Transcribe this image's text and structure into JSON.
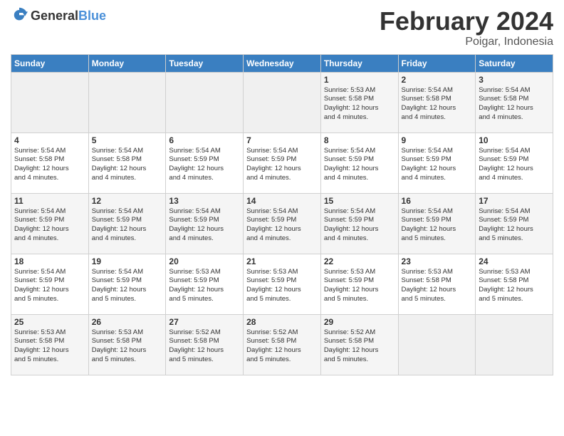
{
  "header": {
    "logo_general": "General",
    "logo_blue": "Blue",
    "month_year": "February 2024",
    "location": "Poigar, Indonesia"
  },
  "weekdays": [
    "Sunday",
    "Monday",
    "Tuesday",
    "Wednesday",
    "Thursday",
    "Friday",
    "Saturday"
  ],
  "weeks": [
    [
      {
        "day": "",
        "info": ""
      },
      {
        "day": "",
        "info": ""
      },
      {
        "day": "",
        "info": ""
      },
      {
        "day": "",
        "info": ""
      },
      {
        "day": "1",
        "info": "Sunrise: 5:53 AM\nSunset: 5:58 PM\nDaylight: 12 hours\nand 4 minutes."
      },
      {
        "day": "2",
        "info": "Sunrise: 5:54 AM\nSunset: 5:58 PM\nDaylight: 12 hours\nand 4 minutes."
      },
      {
        "day": "3",
        "info": "Sunrise: 5:54 AM\nSunset: 5:58 PM\nDaylight: 12 hours\nand 4 minutes."
      }
    ],
    [
      {
        "day": "4",
        "info": "Sunrise: 5:54 AM\nSunset: 5:58 PM\nDaylight: 12 hours\nand 4 minutes."
      },
      {
        "day": "5",
        "info": "Sunrise: 5:54 AM\nSunset: 5:58 PM\nDaylight: 12 hours\nand 4 minutes."
      },
      {
        "day": "6",
        "info": "Sunrise: 5:54 AM\nSunset: 5:59 PM\nDaylight: 12 hours\nand 4 minutes."
      },
      {
        "day": "7",
        "info": "Sunrise: 5:54 AM\nSunset: 5:59 PM\nDaylight: 12 hours\nand 4 minutes."
      },
      {
        "day": "8",
        "info": "Sunrise: 5:54 AM\nSunset: 5:59 PM\nDaylight: 12 hours\nand 4 minutes."
      },
      {
        "day": "9",
        "info": "Sunrise: 5:54 AM\nSunset: 5:59 PM\nDaylight: 12 hours\nand 4 minutes."
      },
      {
        "day": "10",
        "info": "Sunrise: 5:54 AM\nSunset: 5:59 PM\nDaylight: 12 hours\nand 4 minutes."
      }
    ],
    [
      {
        "day": "11",
        "info": "Sunrise: 5:54 AM\nSunset: 5:59 PM\nDaylight: 12 hours\nand 4 minutes."
      },
      {
        "day": "12",
        "info": "Sunrise: 5:54 AM\nSunset: 5:59 PM\nDaylight: 12 hours\nand 4 minutes."
      },
      {
        "day": "13",
        "info": "Sunrise: 5:54 AM\nSunset: 5:59 PM\nDaylight: 12 hours\nand 4 minutes."
      },
      {
        "day": "14",
        "info": "Sunrise: 5:54 AM\nSunset: 5:59 PM\nDaylight: 12 hours\nand 4 minutes."
      },
      {
        "day": "15",
        "info": "Sunrise: 5:54 AM\nSunset: 5:59 PM\nDaylight: 12 hours\nand 4 minutes."
      },
      {
        "day": "16",
        "info": "Sunrise: 5:54 AM\nSunset: 5:59 PM\nDaylight: 12 hours\nand 5 minutes."
      },
      {
        "day": "17",
        "info": "Sunrise: 5:54 AM\nSunset: 5:59 PM\nDaylight: 12 hours\nand 5 minutes."
      }
    ],
    [
      {
        "day": "18",
        "info": "Sunrise: 5:54 AM\nSunset: 5:59 PM\nDaylight: 12 hours\nand 5 minutes."
      },
      {
        "day": "19",
        "info": "Sunrise: 5:54 AM\nSunset: 5:59 PM\nDaylight: 12 hours\nand 5 minutes."
      },
      {
        "day": "20",
        "info": "Sunrise: 5:53 AM\nSunset: 5:59 PM\nDaylight: 12 hours\nand 5 minutes."
      },
      {
        "day": "21",
        "info": "Sunrise: 5:53 AM\nSunset: 5:59 PM\nDaylight: 12 hours\nand 5 minutes."
      },
      {
        "day": "22",
        "info": "Sunrise: 5:53 AM\nSunset: 5:59 PM\nDaylight: 12 hours\nand 5 minutes."
      },
      {
        "day": "23",
        "info": "Sunrise: 5:53 AM\nSunset: 5:58 PM\nDaylight: 12 hours\nand 5 minutes."
      },
      {
        "day": "24",
        "info": "Sunrise: 5:53 AM\nSunset: 5:58 PM\nDaylight: 12 hours\nand 5 minutes."
      }
    ],
    [
      {
        "day": "25",
        "info": "Sunrise: 5:53 AM\nSunset: 5:58 PM\nDaylight: 12 hours\nand 5 minutes."
      },
      {
        "day": "26",
        "info": "Sunrise: 5:53 AM\nSunset: 5:58 PM\nDaylight: 12 hours\nand 5 minutes."
      },
      {
        "day": "27",
        "info": "Sunrise: 5:52 AM\nSunset: 5:58 PM\nDaylight: 12 hours\nand 5 minutes."
      },
      {
        "day": "28",
        "info": "Sunrise: 5:52 AM\nSunset: 5:58 PM\nDaylight: 12 hours\nand 5 minutes."
      },
      {
        "day": "29",
        "info": "Sunrise: 5:52 AM\nSunset: 5:58 PM\nDaylight: 12 hours\nand 5 minutes."
      },
      {
        "day": "",
        "info": ""
      },
      {
        "day": "",
        "info": ""
      }
    ]
  ]
}
